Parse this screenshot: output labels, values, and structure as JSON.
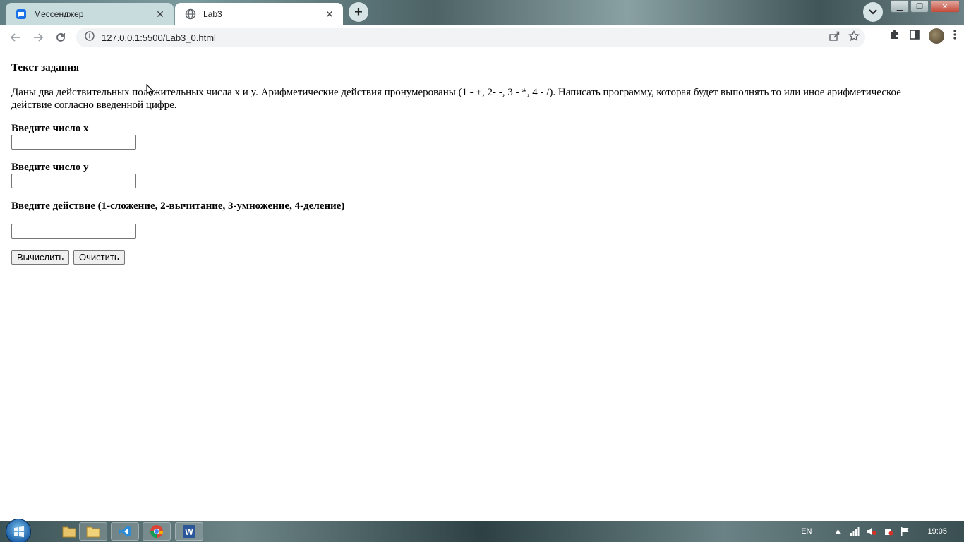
{
  "browser": {
    "tabs": [
      {
        "title": "Мессенджер",
        "active": false,
        "icon": "messenger-icon"
      },
      {
        "title": "Lab3",
        "active": true,
        "icon": "globe-icon"
      }
    ],
    "url": "127.0.0.1:5500/Lab3_0.html"
  },
  "page": {
    "heading": "Текст задания",
    "task_text": "Даны два действительных положительных числа x и y. Арифметические действия пронумерованы (1 - +, 2- -, 3 - *, 4 - /). Написать программу, которая будет выполнять то или иное арифметическое действие согласно введенной цифре.",
    "label_x": "Введите число x",
    "label_y": "Введите число y",
    "label_action": "Введите действие (1-сложение, 2-вычитание, 3-умножение, 4-деление)",
    "input_x_value": "",
    "input_y_value": "",
    "input_action_value": "",
    "calc_button": "Вычислить",
    "clear_button": "Очистить"
  },
  "taskbar": {
    "language": "EN",
    "clock": "19:05"
  },
  "colors": {
    "accent": "#1a73e8",
    "messenger": "#1a73e8"
  }
}
